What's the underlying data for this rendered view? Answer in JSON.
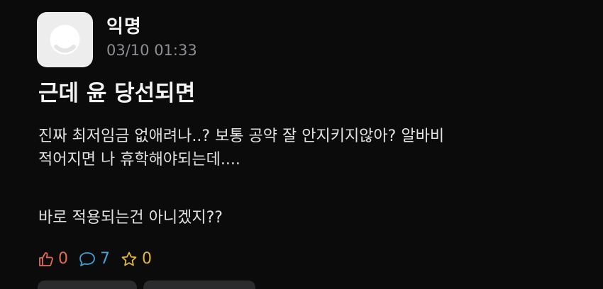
{
  "post": {
    "author": "익명",
    "timestamp": "03/10 01:33",
    "title": "근데 윤 당선되면",
    "body_lines": [
      "진짜 최저임금 없애려나..? 보통 공약 잘 안지키지않아? 알바비",
      "적어지면 나 휴학해야되는데....",
      "바로 적용되는건 아니겠지??"
    ]
  },
  "actions": {
    "likes": "0",
    "comments": "7",
    "scraps": "0"
  },
  "colors": {
    "background": "#0b0b0c",
    "like": "#e36a55",
    "comment": "#3ea3d6",
    "scrap": "#e0b73c",
    "avatar_bg": "#ededed"
  },
  "icons": [
    "thumbs-up-icon",
    "speech-bubble-icon",
    "star-icon"
  ]
}
